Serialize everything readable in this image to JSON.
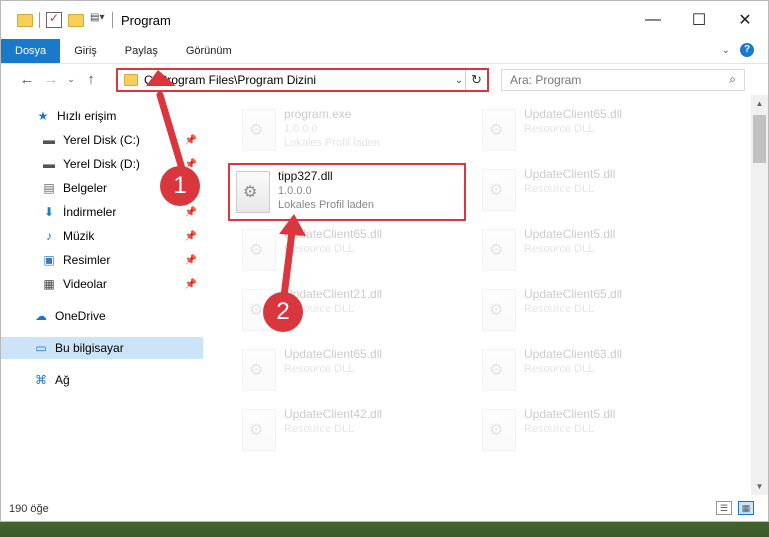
{
  "window": {
    "title": "Program",
    "controls": {
      "minimize": "—",
      "maximize": "☐",
      "close": "✕"
    }
  },
  "ribbon": {
    "tabs": [
      "Dosya",
      "Giriş",
      "Paylaş",
      "Görünüm"
    ],
    "active_tab": "Dosya",
    "help": "?"
  },
  "address_bar": {
    "path": "C:\\Program Files\\Program Dizini",
    "refresh": "↻",
    "dropdown": "⌄"
  },
  "search": {
    "placeholder": "Ara: Program"
  },
  "sidebar": {
    "items": [
      {
        "label": "Hızlı erişim",
        "icon": "star-icon",
        "glyph": "★"
      },
      {
        "label": "Yerel Disk (C:)",
        "icon": "drive-icon",
        "glyph": "▬",
        "pinned": true
      },
      {
        "label": "Yerel Disk (D:)",
        "icon": "drive-icon",
        "glyph": "▬",
        "pinned": true
      },
      {
        "label": "Belgeler",
        "icon": "documents-icon",
        "glyph": "▤",
        "pinned": true
      },
      {
        "label": "İndirmeler",
        "icon": "download-icon",
        "glyph": "⬇",
        "pinned": true
      },
      {
        "label": "Müzik",
        "icon": "music-icon",
        "glyph": "♪",
        "pinned": true
      },
      {
        "label": "Resimler",
        "icon": "pictures-icon",
        "glyph": "▣",
        "pinned": true
      },
      {
        "label": "Videolar",
        "icon": "video-icon",
        "glyph": "▦",
        "pinned": true
      },
      {
        "label": "OneDrive",
        "icon": "cloud-icon",
        "glyph": "☁"
      },
      {
        "label": "Bu bilgisayar",
        "icon": "computer-icon",
        "glyph": "▭"
      },
      {
        "label": "Ağ",
        "icon": "network-icon",
        "glyph": "⌘"
      }
    ]
  },
  "files": [
    {
      "name": "program.exe",
      "line2": "1.0.0.0",
      "line3": "Lokales Profil laden"
    },
    {
      "name": "UpdateClient65.dll",
      "line2": "Resource DLL"
    },
    {
      "name": "tipp327.dll",
      "line2": "1.0.0.0",
      "line3": "Lokales Profil laden"
    },
    {
      "name": "UpdateClient5.dll",
      "line2": "Resource DLL"
    },
    {
      "name": "UpdateClient65.dll",
      "line2": "Resource DLL"
    },
    {
      "name": "UpdateClient5.dll",
      "line2": "Resource DLL"
    },
    {
      "name": "UpdateClient21.dll",
      "line2": "Resource DLL"
    },
    {
      "name": "UpdateClient65.dll",
      "line2": "Resource DLL"
    },
    {
      "name": "UpdateClient65.dll",
      "line2": "Resource DLL"
    },
    {
      "name": "UpdateClient63.dll",
      "line2": "Resource DLL"
    },
    {
      "name": "UpdateClient42.dll",
      "line2": "Resource DLL"
    },
    {
      "name": "UpdateClient5.dll",
      "line2": "Resource DLL"
    }
  ],
  "status": {
    "count": "190 öğe"
  },
  "annotations": {
    "badge1": "1",
    "badge2": "2"
  },
  "colors": {
    "accent": "#1979ca",
    "highlight": "#d9363e"
  }
}
